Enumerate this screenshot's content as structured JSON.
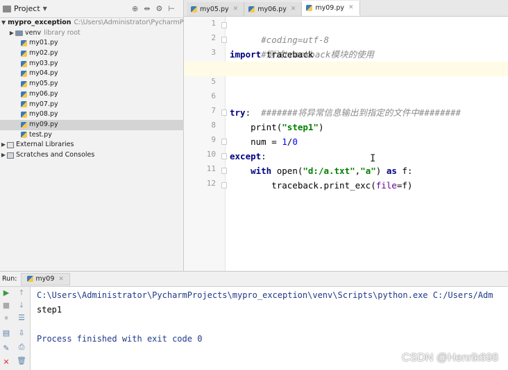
{
  "project_panel": {
    "title": "Project",
    "tools": [
      "⊕",
      "⇹",
      "⚙",
      "⊢"
    ],
    "tree": [
      {
        "label": "mypro_exception",
        "hint": "C:\\Users\\Administrator\\PycharmPro",
        "type": "project",
        "expanded": true
      },
      {
        "label": "venv",
        "hint": "library root",
        "type": "folder"
      },
      {
        "label": "my01.py",
        "type": "py"
      },
      {
        "label": "my02.py",
        "type": "py"
      },
      {
        "label": "my03.py",
        "type": "py"
      },
      {
        "label": "my04.py",
        "type": "py"
      },
      {
        "label": "my05.py",
        "type": "py"
      },
      {
        "label": "my06.py",
        "type": "py"
      },
      {
        "label": "my07.py",
        "type": "py"
      },
      {
        "label": "my08.py",
        "type": "py"
      },
      {
        "label": "my09.py",
        "type": "py",
        "selected": true
      },
      {
        "label": "test.py",
        "type": "py"
      },
      {
        "label": "External Libraries",
        "type": "lib"
      },
      {
        "label": "Scratches and Consoles",
        "type": "scratch"
      }
    ]
  },
  "editor": {
    "tabs": [
      {
        "label": "my05.py",
        "active": false
      },
      {
        "label": "my06.py",
        "active": false
      },
      {
        "label": "my09.py",
        "active": true
      }
    ],
    "line_numbers": [
      "1",
      "2",
      "3",
      "4",
      "5",
      "6",
      "7",
      "8",
      "9",
      "10",
      "11",
      "12"
    ],
    "lines": {
      "l1": "#coding=utf-8",
      "l2": "#测试trackback模块的使用",
      "l3_kw": "import",
      "l3_rest": " traceback",
      "l6": "#######将异常信息输出到指定的文件中########",
      "l7_kw": "try",
      "l7_rest": ":",
      "l8_indent": "    ",
      "l8_fn": "print(",
      "l8_str": "\"step1\"",
      "l8_end": ")",
      "l9_a": "    num = ",
      "l9_n1": "1",
      "l9_op": "/",
      "l9_n2": "0",
      "l10_kw": "except",
      "l10_rest": ":",
      "l11_indent": "    ",
      "l11_kw": "with",
      "l11_a": " open(",
      "l11_s1": "\"d:/a.txt\"",
      "l11_comma": ",",
      "l11_s2": "\"a\"",
      "l11_b": ") ",
      "l11_kw2": "as",
      "l11_c": " f:",
      "l12_a": "        traceback.print_exc(",
      "l12_param": "file",
      "l12_b": "=f)"
    }
  },
  "run_panel": {
    "label": "Run:",
    "tab": "my09",
    "console": {
      "command": "C:\\Users\\Administrator\\PycharmProjects\\mypro_exception\\venv\\Scripts\\python.exe C:/Users/Adm",
      "output": "step1",
      "exit": "Process finished with exit code 0"
    }
  },
  "watermark": "CSDN @Henrik698",
  "colors": {
    "keyword": "#000080",
    "string": "#008000",
    "number": "#0000ff",
    "comment": "#8a8a8a",
    "console_path": "#1f3a8a"
  }
}
